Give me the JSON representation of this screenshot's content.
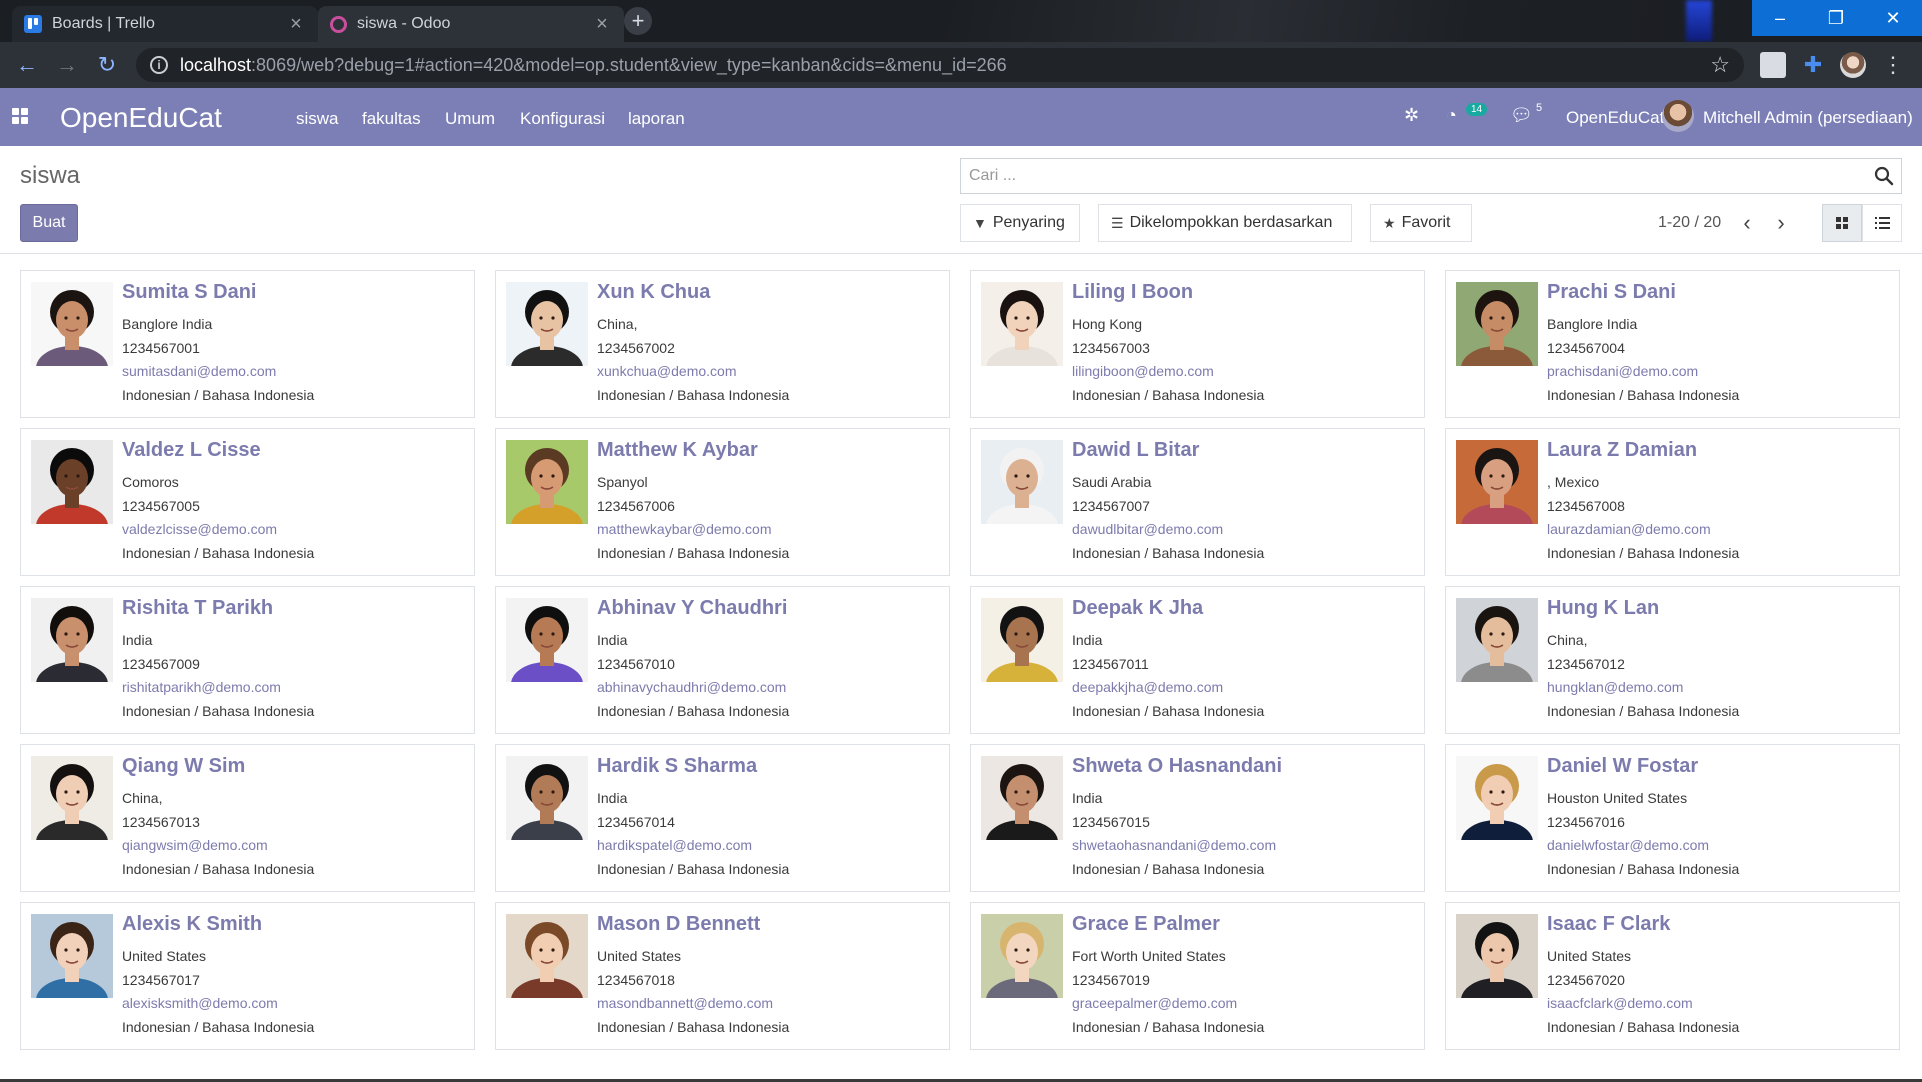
{
  "browser": {
    "tabs": [
      {
        "title": "Boards | Trello",
        "icon": "trello-icon"
      },
      {
        "title": "siswa - Odoo",
        "icon": "odoo-icon"
      }
    ],
    "url_host": "localhost",
    "url_path": ":8069/web?debug=1#action=420&model=op.student&view_type=kanban&cids=&menu_id=266"
  },
  "navbar": {
    "brand": "OpenEduCat",
    "menus": [
      "siswa",
      "fakultas",
      "Umum",
      "Konfigurasi",
      "laporan"
    ],
    "activity_count": "14",
    "message_count": "5",
    "company": "OpenEduCat",
    "user": "Mitchell Admin (persediaan)"
  },
  "control_panel": {
    "breadcrumb": "siswa",
    "create_label": "Buat",
    "search_placeholder": "Cari ...",
    "filter_label": "Penyaring",
    "groupby_label": "Dikelompokkan berdasarkan",
    "favorite_label": "Favorit",
    "pager": "1-20 / 20"
  },
  "colors": {
    "brand_purple": "#7b7fb6",
    "link_purple": "#7c7bad"
  },
  "students": [
    {
      "name": "Sumita S Dani",
      "address": "Banglore India",
      "phone": "1234567001",
      "email": "sumitasdani@demo.com",
      "lang": "Indonesian / Bahasa Indonesia"
    },
    {
      "name": "Xun K Chua",
      "address": "China,",
      "phone": "1234567002",
      "email": "xunkchua@demo.com",
      "lang": "Indonesian / Bahasa Indonesia"
    },
    {
      "name": "Liling I Boon",
      "address": "Hong Kong",
      "phone": "1234567003",
      "email": "lilingiboon@demo.com",
      "lang": "Indonesian / Bahasa Indonesia"
    },
    {
      "name": "Prachi S Dani",
      "address": "Banglore India",
      "phone": "1234567004",
      "email": "prachisdani@demo.com",
      "lang": "Indonesian / Bahasa Indonesia"
    },
    {
      "name": "Valdez L Cisse",
      "address": "Comoros",
      "phone": "1234567005",
      "email": "valdezlcisse@demo.com",
      "lang": "Indonesian / Bahasa Indonesia"
    },
    {
      "name": "Matthew K Aybar",
      "address": "Spanyol",
      "phone": "1234567006",
      "email": "matthewkaybar@demo.com",
      "lang": "Indonesian / Bahasa Indonesia"
    },
    {
      "name": "Dawid L Bitar",
      "address": "Saudi Arabia",
      "phone": "1234567007",
      "email": "dawudlbitar@demo.com",
      "lang": "Indonesian / Bahasa Indonesia"
    },
    {
      "name": "Laura Z Damian",
      "address": ", Mexico",
      "phone": "1234567008",
      "email": "laurazdamian@demo.com",
      "lang": "Indonesian / Bahasa Indonesia"
    },
    {
      "name": "Rishita T Parikh",
      "address": "India",
      "phone": "1234567009",
      "email": "rishitatparikh@demo.com",
      "lang": "Indonesian / Bahasa Indonesia"
    },
    {
      "name": "Abhinav Y Chaudhri",
      "address": "India",
      "phone": "1234567010",
      "email": "abhinavychaudhri@demo.com",
      "lang": "Indonesian / Bahasa Indonesia"
    },
    {
      "name": "Deepak K Jha",
      "address": "India",
      "phone": "1234567011",
      "email": "deepakkjha@demo.com",
      "lang": "Indonesian / Bahasa Indonesia"
    },
    {
      "name": "Hung K Lan",
      "address": "China,",
      "phone": "1234567012",
      "email": "hungklan@demo.com",
      "lang": "Indonesian / Bahasa Indonesia"
    },
    {
      "name": "Qiang W Sim",
      "address": "China,",
      "phone": "1234567013",
      "email": "qiangwsim@demo.com",
      "lang": "Indonesian / Bahasa Indonesia"
    },
    {
      "name": "Hardik S Sharma",
      "address": "India",
      "phone": "1234567014",
      "email": "hardikspatel@demo.com",
      "lang": "Indonesian / Bahasa Indonesia"
    },
    {
      "name": "Shweta O Hasnandani",
      "address": "India",
      "phone": "1234567015",
      "email": "shwetaohasnandani@demo.com",
      "lang": "Indonesian / Bahasa Indonesia"
    },
    {
      "name": "Daniel W Fostar",
      "address": "Houston United States",
      "phone": "1234567016",
      "email": "danielwfostar@demo.com",
      "lang": "Indonesian / Bahasa Indonesia"
    },
    {
      "name": "Alexis K Smith",
      "address": "United States",
      "phone": "1234567017",
      "email": "alexisksmith@demo.com",
      "lang": "Indonesian / Bahasa Indonesia"
    },
    {
      "name": "Mason D Bennett",
      "address": "United States",
      "phone": "1234567018",
      "email": "masondbannett@demo.com",
      "lang": "Indonesian / Bahasa Indonesia"
    },
    {
      "name": "Grace E Palmer",
      "address": "Fort Worth United States",
      "phone": "1234567019",
      "email": "graceepalmer@demo.com",
      "lang": "Indonesian / Bahasa Indonesia"
    },
    {
      "name": "Isaac F Clark",
      "address": "United States",
      "phone": "1234567020",
      "email": "isaacfclark@demo.com",
      "lang": "Indonesian / Bahasa Indonesia"
    }
  ]
}
